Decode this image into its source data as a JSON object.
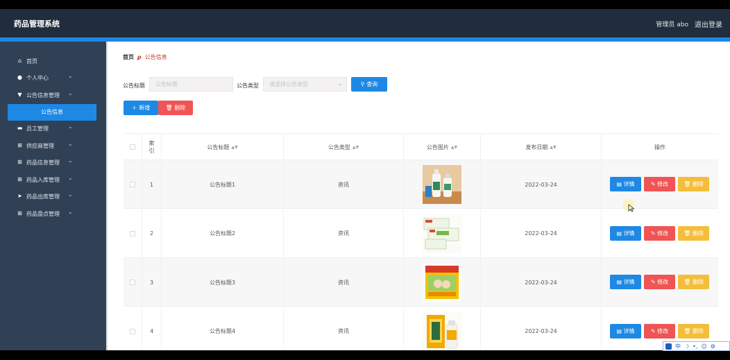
{
  "header": {
    "app_title": "药品管理系统",
    "user_label": "管理员 abo",
    "logout_label": "退出登录"
  },
  "sidebar": {
    "items": [
      {
        "label": "首页",
        "icon": "home-icon",
        "glyph": "⌂",
        "has_children": false
      },
      {
        "label": "个人中心",
        "icon": "user-icon",
        "glyph": "●",
        "has_children": true
      },
      {
        "label": "公告信息管理",
        "icon": "notice-icon",
        "glyph": "▼",
        "has_children": true
      },
      {
        "label": "员工管理",
        "icon": "staff-icon",
        "glyph": "▬",
        "has_children": true
      },
      {
        "label": "供应商管理",
        "icon": "grid-icon",
        "glyph": "⊞",
        "has_children": true
      },
      {
        "label": "药品信息管理",
        "icon": "grid-icon",
        "glyph": "⊞",
        "has_children": true
      },
      {
        "label": "药品入库管理",
        "icon": "grid-icon",
        "glyph": "⊞",
        "has_children": true
      },
      {
        "label": "药品出库管理",
        "icon": "send-icon",
        "glyph": "➤",
        "has_children": true
      },
      {
        "label": "药品盘点管理",
        "icon": "grid-icon",
        "glyph": "⊞",
        "has_children": true
      }
    ],
    "active_sub_item": "公告信息"
  },
  "breadcrumb": {
    "home": "首页",
    "current": "公告信息"
  },
  "filters": {
    "title_label": "公告标题",
    "title_placeholder": "公告标题",
    "type_label": "公告类型",
    "type_placeholder": "请选择公告类型",
    "search_label": "查询"
  },
  "actions": {
    "add_label": "新增",
    "delete_label": "删除"
  },
  "table": {
    "columns": {
      "index": "索引",
      "title": "公告标题",
      "type": "公告类型",
      "image": "公告图片",
      "date": "发布日期",
      "ops": "操作"
    },
    "rows": [
      {
        "index": "1",
        "title": "公告标题1",
        "type": "资讯",
        "date": "2022-03-24",
        "image": "product-photo-bottles"
      },
      {
        "index": "2",
        "title": "公告标题2",
        "type": "资讯",
        "date": "2022-03-24",
        "image": "product-photo-boxes"
      },
      {
        "index": "3",
        "title": "公告标题3",
        "type": "资讯",
        "date": "2022-03-24",
        "image": "product-photo-yellow-box"
      },
      {
        "index": "4",
        "title": "公告标题4",
        "type": "资讯",
        "date": "2022-03-24",
        "image": "product-photo-box-bottle"
      }
    ],
    "row_buttons": {
      "detail": "详情",
      "edit": "修改",
      "delete": "删除"
    }
  },
  "ime_bar": {
    "lang": "中"
  },
  "colors": {
    "topbar": "#1f2d3d",
    "sidebar": "#304156",
    "accent": "#1e88e5",
    "danger": "#f05454",
    "warning": "#f4be3a"
  }
}
